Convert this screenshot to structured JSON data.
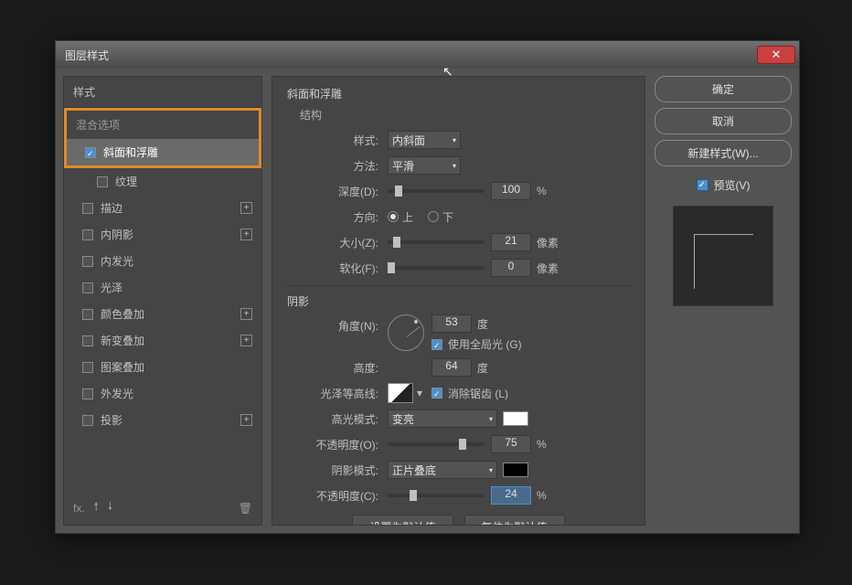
{
  "dialog": {
    "title": "图层样式"
  },
  "left": {
    "header": "样式",
    "blend": "混合选项",
    "items": [
      {
        "key": "bevel",
        "label": "斜面和浮雕",
        "checked": true,
        "selected": true,
        "plus": false,
        "sub": false
      },
      {
        "key": "texture",
        "label": "纹理",
        "checked": false,
        "plus": false,
        "sub": true
      },
      {
        "key": "stroke",
        "label": "描边",
        "checked": false,
        "plus": true
      },
      {
        "key": "inner-shadow",
        "label": "内阴影",
        "checked": false,
        "plus": true
      },
      {
        "key": "inner-glow",
        "label": "内发光",
        "checked": false,
        "plus": false
      },
      {
        "key": "satin",
        "label": "光泽",
        "checked": false,
        "plus": false
      },
      {
        "key": "color-overlay",
        "label": "颜色叠加",
        "checked": false,
        "plus": true
      },
      {
        "key": "gradient-overlay",
        "label": "新变叠加",
        "checked": false,
        "plus": true
      },
      {
        "key": "pattern-overlay",
        "label": "图案叠加",
        "checked": false,
        "plus": false
      },
      {
        "key": "outer-glow",
        "label": "外发光",
        "checked": false,
        "plus": false
      },
      {
        "key": "drop-shadow",
        "label": "投影",
        "checked": false,
        "plus": true
      }
    ]
  },
  "center": {
    "title": "斜面和浮雕",
    "structure": "结构",
    "style_label": "样式:",
    "style_value": "内斜面",
    "method_label": "方法:",
    "method_value": "平滑",
    "depth_label": "深度(D):",
    "depth_value": "100",
    "depth_unit": "%",
    "direction_label": "方向:",
    "dir_up": "上",
    "dir_down": "下",
    "size_label": "大小(Z):",
    "size_value": "21",
    "size_unit": "像素",
    "soften_label": "软化(F):",
    "soften_value": "0",
    "soften_unit": "像素",
    "shading": "阴影",
    "angle_label": "角度(N):",
    "angle_value": "53",
    "angle_unit": "度",
    "global_light": "使用全局光 (G)",
    "altitude_label": "高度:",
    "altitude_value": "64",
    "altitude_unit": "度",
    "gloss_label": "光泽等高线:",
    "antialias": "消除锯齿 (L)",
    "highlight_mode_label": "高光模式:",
    "highlight_mode_value": "变亮",
    "highlight_opacity_label": "不透明度(O):",
    "highlight_opacity_value": "75",
    "opacity_unit": "%",
    "shadow_mode_label": "阴影模式:",
    "shadow_mode_value": "正片叠底",
    "shadow_opacity_label": "不透明度(C):",
    "shadow_opacity_value": "24",
    "make_default": "设置为默认值",
    "reset_default": "复位为默认值"
  },
  "right": {
    "ok": "确定",
    "cancel": "取消",
    "new_style": "新建样式(W)...",
    "preview": "预览(V)"
  }
}
